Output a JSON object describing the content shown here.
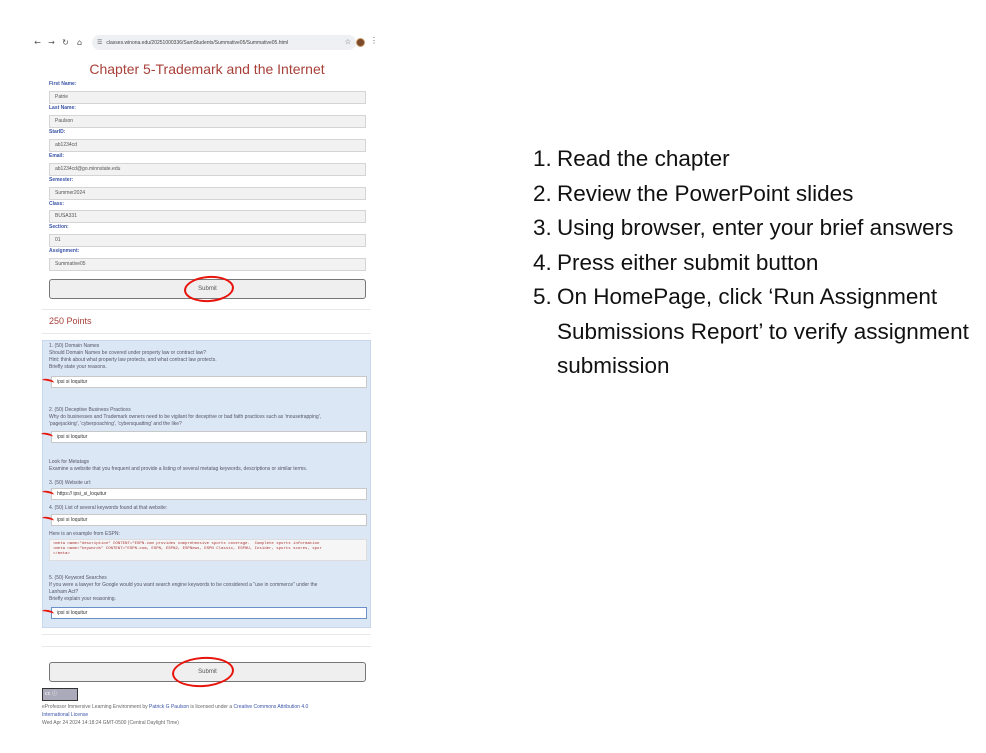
{
  "browser": {
    "url": "classes.winona.edu/20251000336/SamStudents/Summative05/Summative05.html",
    "nav_icons": [
      "back-icon",
      "forward-icon",
      "reload-icon",
      "home-icon"
    ]
  },
  "page": {
    "title": "Chapter 5-Trademark and the Internet",
    "fields": [
      {
        "label": "First Name:",
        "value": "Patrie"
      },
      {
        "label": "Last Name:",
        "value": "Paulson"
      },
      {
        "label": "StarID:",
        "value": "ab1234cd"
      },
      {
        "label": "Email:",
        "value": "ab1234cd@go.minnstate.edu"
      },
      {
        "label": "Semester:",
        "value": "Summer2024"
      },
      {
        "label": "Class:",
        "value": "BUSA331"
      },
      {
        "label": "Section:",
        "value": "01"
      },
      {
        "label": "Assignment:",
        "value": "Summative05"
      }
    ],
    "submit_label": "Submit",
    "points": "250 Points",
    "questions": {
      "q1_lines": [
        "1. (50) Domain Names",
        "Should Domain Names be covered under property law or contract law?",
        "Hint: think about what property law protects, and what contract law protects.",
        "Briefly state your reasons."
      ],
      "q1_answer": "ipsi si loquitur",
      "q2_lines": [
        "2. (50) Deceptive Business Practices",
        "Why do businesses and Trademark owners need to be vigilant for deceptive or bad faith practices such as 'mousetrapping',",
        "'pagejacking', 'cyberpoaching', 'cybersquatting' and the like?"
      ],
      "q2_answer": "ipsi si loquitur",
      "meta_lines": [
        "Look for Metatags",
        "Examine a website that you frequent and provide a listing of several metatag keywords, descriptions or similar terms."
      ],
      "q3_label": "3. (50) Website url:",
      "q3_answer": "https:// ipsi_si_loquitur",
      "q4_label": "4. (50) List of several keywords found at that website:",
      "q4_answer": "ipsi si loquitur",
      "example_label": "Here is an example from ESPN:",
      "code": "<meta name=\"description\" CONTENT=\"ESPN.com provides comprehensive sports coverage.  Complete sports information\n<meta name=\"keywords\" CONTENT=\"ESPN.com, ESPN, ESPN2, ESPNews, ESPN Classic, ESPNU, Insider, sports scores, spor\n</meta>",
      "q5_lines": [
        "5. (50) Keyword Searches",
        "If you were a lawyer for Google would you want search engine keywords to be considered a \"use in commerce\" under the",
        "Lanham Act?",
        "Briefly explain your reasoning."
      ],
      "q5_answer": "ipsi si loquitur"
    },
    "footer": {
      "cc_badge": "cc ⓘ",
      "line1_pre": "eProfessor Immersive Learning Environment by ",
      "author": "Patrick G Paulson",
      "line1_mid": " is licensed under a ",
      "license": "Creative Commons Attribution 4.0",
      "license2": "International License",
      "timestamp": "Wed Apr 24 2024 14:18:24 GMT-0500 (Central Daylight Time)"
    }
  },
  "instructions": [
    {
      "num": "1.",
      "text": "Read the chapter"
    },
    {
      "num": "2.",
      "text": "Review the PowerPoint slides"
    },
    {
      "num": "3.",
      "text": "Using browser, enter your brief answers"
    },
    {
      "num": "4.",
      "text": "Press either submit button"
    },
    {
      "num": "5.",
      "text": "On HomePage, click ‘Run Assignment Submissions Report’ to verify assignment submission"
    }
  ],
  "colors": {
    "title": "#a8403a",
    "label": "#3a54a8",
    "panel": "#dbe7f5",
    "annotation": "#e8140c"
  }
}
